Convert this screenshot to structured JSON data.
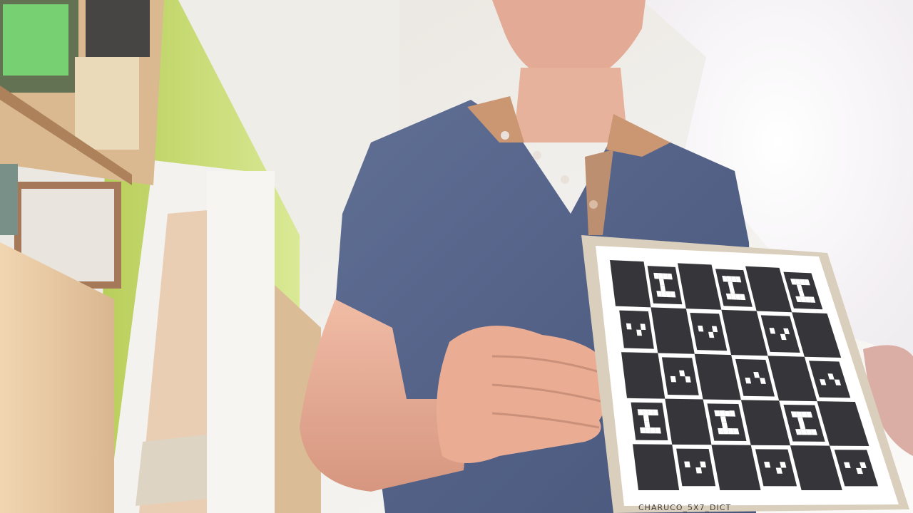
{
  "scene": {
    "kind": "photo",
    "subject": "person-holding-charuco-board",
    "board": {
      "rows": 5,
      "cols": 6,
      "caption": "CHARUCO_5X7_DICT",
      "colors": {
        "frame": "#d8cdb8",
        "paper": "#ffffff",
        "square": "#2a2a2e"
      }
    },
    "palette": {
      "wall_left": "#c8dc60",
      "ceiling": "#f2f0ec",
      "window": "#ffffff",
      "shirt": "#4a5a82",
      "skin": "#e8a890",
      "wood": "#e8c8a0"
    }
  }
}
